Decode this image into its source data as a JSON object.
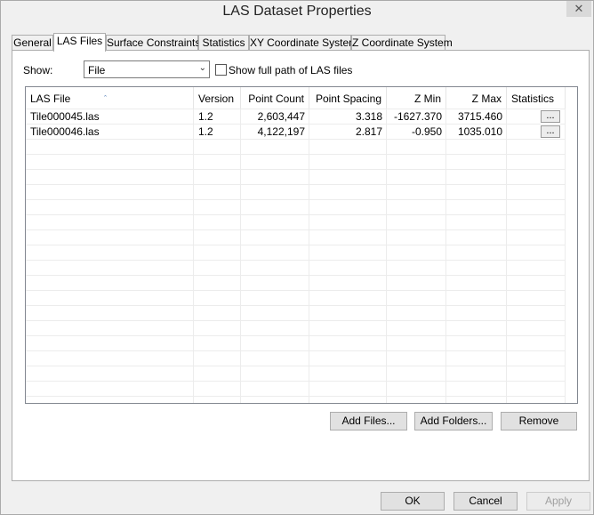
{
  "window": {
    "title": "LAS Dataset Properties",
    "close_glyph": "✕"
  },
  "tabs": [
    {
      "label": "General",
      "active": false
    },
    {
      "label": "LAS Files",
      "active": true
    },
    {
      "label": "Surface Constraints",
      "active": false
    },
    {
      "label": "Statistics",
      "active": false
    },
    {
      "label": "XY Coordinate System",
      "active": false
    },
    {
      "label": "Z Coordinate System",
      "active": false
    }
  ],
  "show": {
    "label": "Show:",
    "selected": "File",
    "arrow_glyph": "⌄"
  },
  "full_path_checkbox": {
    "label": "Show full path of LAS files",
    "checked": false
  },
  "table": {
    "sort_glyph": "ˆ",
    "columns": [
      "LAS File",
      "Version",
      "Point Count",
      "Point Spacing",
      "Z Min",
      "Z Max",
      "Statistics"
    ],
    "rows": [
      [
        "Tile000045.las",
        "1.2",
        "2,603,447",
        "3.318",
        "-1627.370",
        "3715.460",
        "..."
      ],
      [
        "Tile000046.las",
        "1.2",
        "4,122,197",
        "2.817",
        "-0.950",
        "1035.010",
        "..."
      ]
    ]
  },
  "file_buttons": {
    "add_files": "Add Files...",
    "add_folders": "Add Folders...",
    "remove": "Remove"
  },
  "dialog_buttons": {
    "ok": "OK",
    "cancel": "Cancel",
    "apply": "Apply"
  }
}
